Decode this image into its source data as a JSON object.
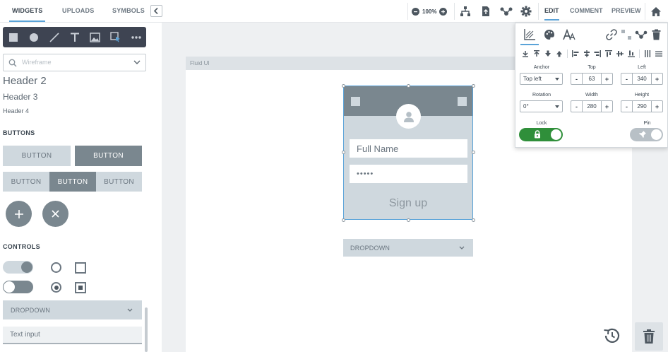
{
  "top_left_tabs": [
    "WIDGETS",
    "UPLOADS",
    "SYMBOLS"
  ],
  "zoom": "100%",
  "right_tabs": [
    "EDIT",
    "COMMENT",
    "PREVIEW"
  ],
  "library": {
    "placeholder": "Wireframe"
  },
  "headers": {
    "h2": "Header 2",
    "h3": "Header 3",
    "h4": "Header 4"
  },
  "sections": {
    "buttons": "BUTTONS",
    "controls": "CONTROLS"
  },
  "buttons": {
    "primary_light": "BUTTON",
    "primary_dark": "BUTTON",
    "seg_left": "BUTTON",
    "seg_mid": "BUTTON",
    "seg_right": "BUTTON"
  },
  "controls": {
    "dropdown": "DROPDOWN",
    "text_input": "Text input"
  },
  "canvas": {
    "artboard_label": "Fluid UI",
    "full_name": "Full Name",
    "password": "•••••",
    "signup": "Sign up",
    "dropdown": "DROPDOWN"
  },
  "props": {
    "anchor_label": "Anchor",
    "anchor_value": "Top left",
    "top_label": "Top",
    "top_value": "63",
    "left_label": "Left",
    "left_value": "340",
    "rotation_label": "Rotation",
    "rotation_value": "0°",
    "width_label": "Width",
    "width_value": "280",
    "height_label": "Height",
    "height_value": "290",
    "lock_label": "Lock",
    "pin_label": "Pin",
    "minus": "-",
    "plus": "+"
  },
  "colors": {
    "accent": "#5aa3d8",
    "toolbar": "#3e4452",
    "widget_light": "#cfd8de",
    "widget_dark": "#7a878f",
    "lock_on": "#2f8f3a"
  }
}
